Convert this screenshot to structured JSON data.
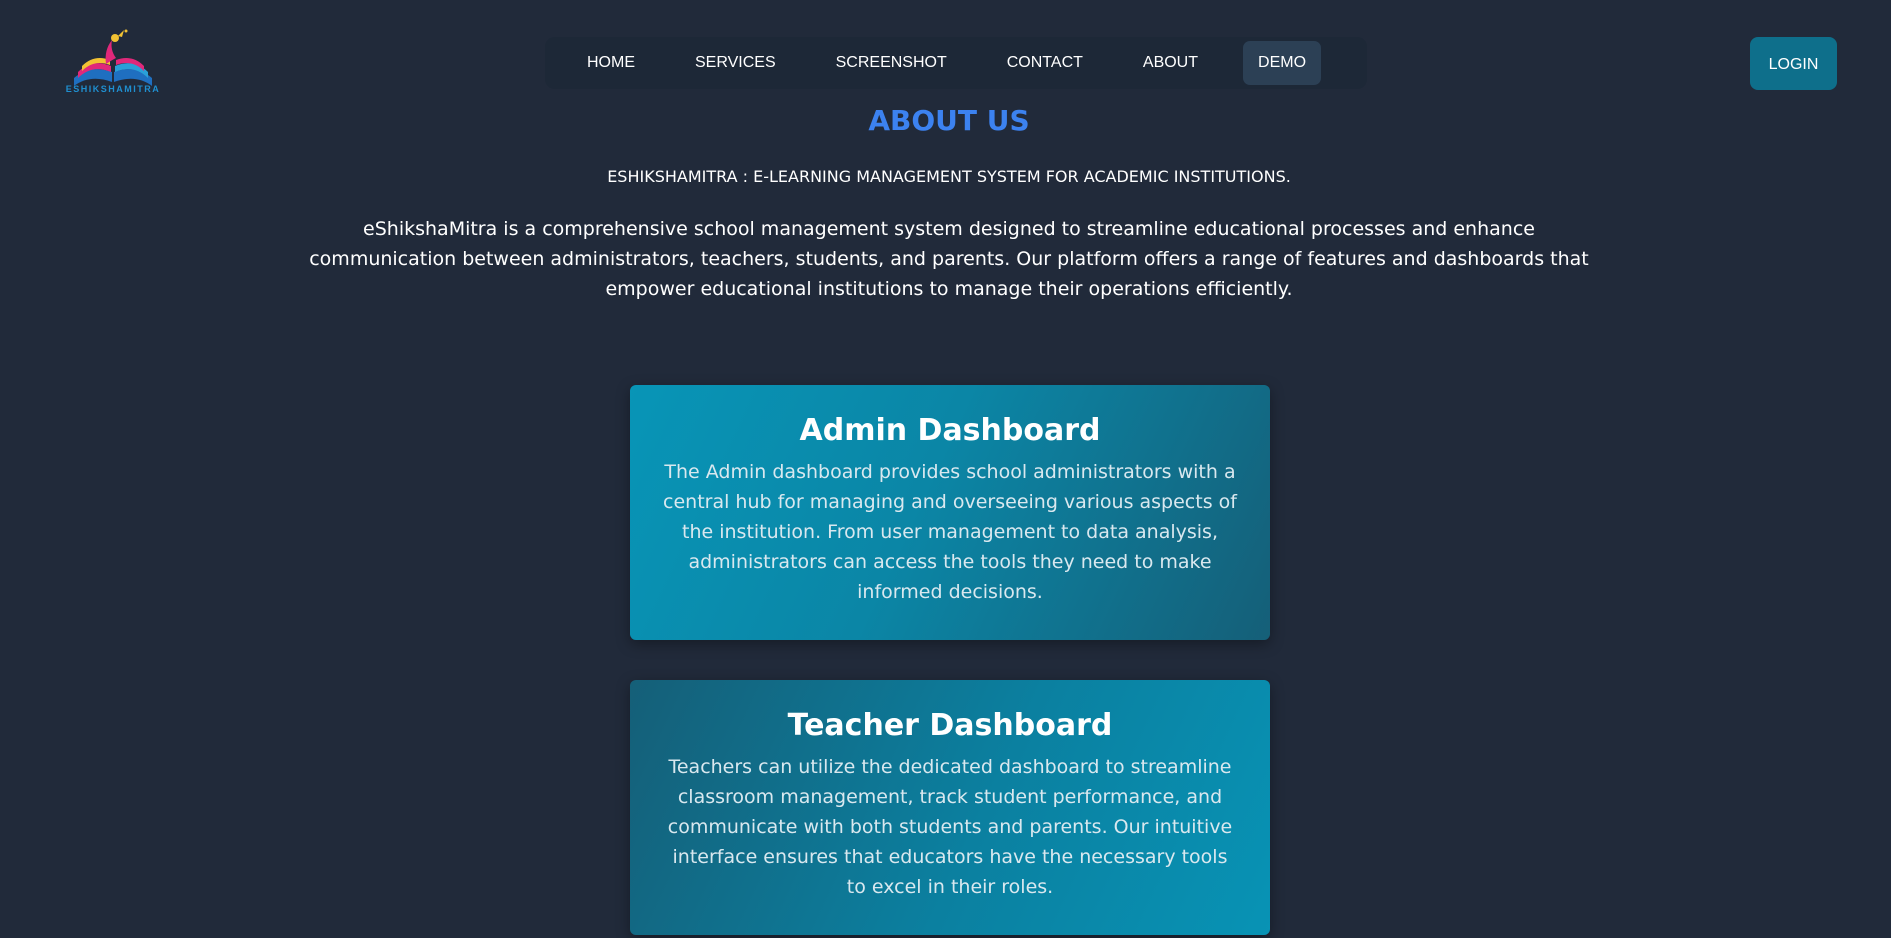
{
  "brand": {
    "logo_text": "ESHIKSHAMITRA"
  },
  "nav": {
    "items": [
      {
        "label": "HOME"
      },
      {
        "label": "SERVICES"
      },
      {
        "label": "SCREENSHOT"
      },
      {
        "label": "CONTACT"
      },
      {
        "label": "ABOUT"
      },
      {
        "label": "DEMO"
      }
    ],
    "active": "DEMO"
  },
  "header": {
    "login_label": "LOGIN"
  },
  "about": {
    "title": "ABOUT US",
    "subtitle": "ESHIKSHAMITRA : E-LEARNING MANAGEMENT SYSTEM FOR ACADEMIC INSTITUTIONS.",
    "description": "eShikshaMitra is a comprehensive school management system designed to streamline educational processes and enhance communication between administrators, teachers, students, and parents. Our platform offers a range of features and dashboards that empower educational institutions to manage their operations efficiently."
  },
  "cards": [
    {
      "title": "Admin Dashboard",
      "text": "The Admin dashboard provides school administrators with a central hub for managing and overseeing various aspects of the institution. From user management to data analysis, administrators can access the tools they need to make informed decisions."
    },
    {
      "title": "Teacher Dashboard",
      "text": "Teachers can utilize the dedicated dashboard to streamline classroom management, track student performance, and communicate with both students and parents. Our intuitive interface ensures that educators have the necessary tools to excel in their roles."
    }
  ],
  "colors": {
    "background": "#212a3a",
    "accent_title": "#3c82f0",
    "login_button": "#0e6f8b",
    "nav_active": "#2c4055",
    "card_primary": "#0895b7",
    "card_secondary": "#155f78"
  }
}
